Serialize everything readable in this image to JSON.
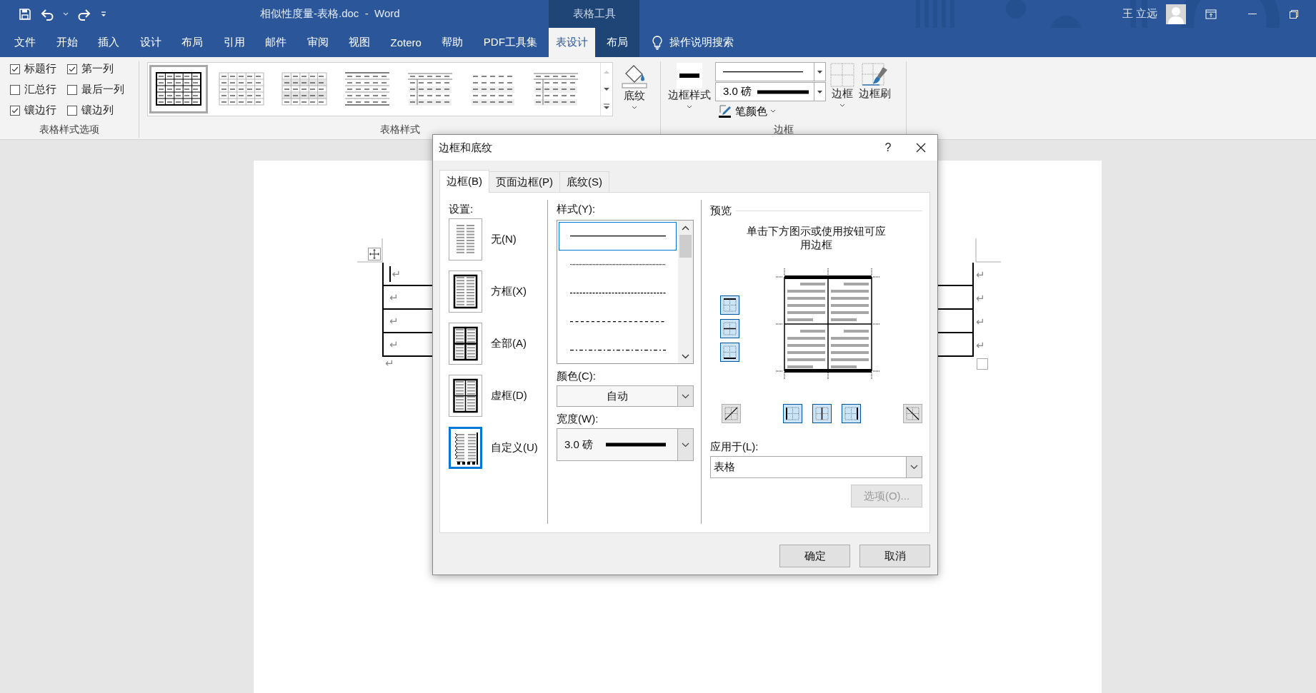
{
  "title_bar": {
    "title": "相似性度量-表格.doc  -  Word",
    "context_group": "表格工具",
    "user_name": "王 立远"
  },
  "menu_tabs": [
    {
      "label": "文件",
      "selected": false,
      "contextual": false
    },
    {
      "label": "开始",
      "selected": false,
      "contextual": false
    },
    {
      "label": "插入",
      "selected": false,
      "contextual": false
    },
    {
      "label": "设计",
      "selected": false,
      "contextual": false
    },
    {
      "label": "布局",
      "selected": false,
      "contextual": false
    },
    {
      "label": "引用",
      "selected": false,
      "contextual": false
    },
    {
      "label": "邮件",
      "selected": false,
      "contextual": false
    },
    {
      "label": "审阅",
      "selected": false,
      "contextual": false
    },
    {
      "label": "视图",
      "selected": false,
      "contextual": false
    },
    {
      "label": "Zotero",
      "selected": false,
      "contextual": false
    },
    {
      "label": "帮助",
      "selected": false,
      "contextual": false
    },
    {
      "label": "PDF工具集",
      "selected": false,
      "contextual": false
    },
    {
      "label": "表设计",
      "selected": true,
      "contextual": true
    },
    {
      "label": "布局",
      "selected": false,
      "contextual": true
    }
  ],
  "tell_me": {
    "label": "操作说明搜索"
  },
  "ribbon": {
    "style_options": {
      "group_label": "表格样式选项",
      "options": [
        {
          "label": "标题行",
          "checked": true
        },
        {
          "label": "第一列",
          "checked": true
        },
        {
          "label": "汇总行",
          "checked": false
        },
        {
          "label": "最后一列",
          "checked": false
        },
        {
          "label": "镶边行",
          "checked": true
        },
        {
          "label": "镶边列",
          "checked": false
        }
      ]
    },
    "table_styles": {
      "group_label": "表格样式",
      "shading_button": "底纹",
      "styles": [
        {
          "kind": "grid",
          "selected": true
        },
        {
          "kind": "light-grid",
          "selected": false
        },
        {
          "kind": "banded-grid",
          "selected": false
        },
        {
          "kind": "rules",
          "selected": false
        },
        {
          "kind": "header-rule",
          "selected": false
        },
        {
          "kind": "plain",
          "selected": false
        },
        {
          "kind": "banded-rule",
          "selected": false
        }
      ]
    },
    "borders": {
      "group_label": "边框",
      "border_styles_button": "边框样式",
      "pen_line": {
        "kind": "solid"
      },
      "line_weight": "3.0 磅",
      "pen_color_button": "笔颜色",
      "borders_button": "边框",
      "border_painter_button": "边框刷"
    }
  },
  "document": {
    "table_rows": [
      {
        "cell_mark": "↵",
        "end_mark": "↵",
        "cursor": true
      },
      {
        "cell_mark": "↵",
        "end_mark": "↵",
        "cursor": false
      },
      {
        "cell_mark": "↵",
        "end_mark": "↵",
        "cursor": false
      },
      {
        "cell_mark": "↵",
        "end_mark": "↵",
        "cursor": false
      }
    ],
    "paragraph_mark": "↵"
  },
  "dialog": {
    "title": "边框和底纹",
    "help": "?",
    "tabs": [
      {
        "label": "边框(B)",
        "selected": true
      },
      {
        "label": "页面边框(P)",
        "selected": false
      },
      {
        "label": "底纹(S)",
        "selected": false
      }
    ],
    "setting": {
      "label": "设置:",
      "items": [
        {
          "label": "无(N)",
          "kind": "none",
          "selected": false
        },
        {
          "label": "方框(X)",
          "kind": "box",
          "selected": false
        },
        {
          "label": "全部(A)",
          "kind": "all",
          "selected": false
        },
        {
          "label": "虚框(D)",
          "kind": "grid",
          "selected": false
        },
        {
          "label": "自定义(U)",
          "kind": "custom",
          "selected": true
        }
      ]
    },
    "style": {
      "label": "样式(Y):",
      "lines": [
        {
          "kind": "solid",
          "selected": true
        },
        {
          "kind": "dotted",
          "selected": false
        },
        {
          "kind": "dense-dash",
          "selected": false
        },
        {
          "kind": "dash",
          "selected": false
        },
        {
          "kind": "dash-dot",
          "selected": false
        }
      ]
    },
    "color": {
      "label": "颜色(C):",
      "value": "自动"
    },
    "width": {
      "label": "宽度(W):",
      "value": "3.0 磅"
    },
    "preview": {
      "label": "预览",
      "hint": "单击下方图示或使用按钮可应用边框",
      "side_buttons": [
        {
          "kind": "top",
          "on": true
        },
        {
          "kind": "inside-horizontal",
          "on": true
        },
        {
          "kind": "bottom",
          "on": true
        }
      ],
      "bottom_buttons": [
        {
          "kind": "diagonal-up",
          "on": false
        },
        {
          "kind": "left",
          "on": true
        },
        {
          "kind": "inside-vertical",
          "on": true
        },
        {
          "kind": "right",
          "on": true
        },
        {
          "kind": "diagonal-down",
          "on": false
        }
      ]
    },
    "apply_to": {
      "label": "应用于(L):",
      "value": "表格"
    },
    "options_button": {
      "label": "选项(O)...",
      "disabled": true
    },
    "buttons": [
      {
        "label": "确定"
      },
      {
        "label": "取消"
      }
    ]
  }
}
